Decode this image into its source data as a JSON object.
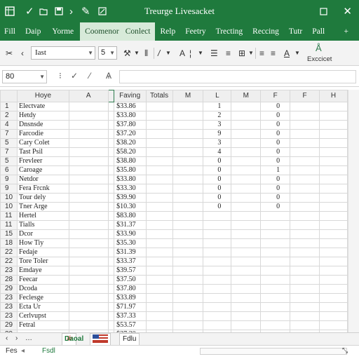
{
  "window": {
    "title": "Treurge Livesacket",
    "app_icon": "spreadsheet-icon",
    "qa_icons": [
      "check-icon",
      "folder-icon",
      "box-icon",
      "chevron-right-icon",
      "edit-icon"
    ],
    "right_icons": [
      "restore-icon",
      "close-icon"
    ]
  },
  "ribbon": {
    "tabs": [
      "Fill",
      "Daip",
      "Yorme",
      "Coomenor",
      "Conlect",
      "Relp",
      "Feetry",
      "Trecting",
      "Reccing",
      "Tutr",
      "Pall"
    ],
    "active_index": 3,
    "collapse_icon": "plus-icon"
  },
  "toolbar": {
    "font_name": "Iast",
    "font_size": "5",
    "excelt_label": "Exccicet"
  },
  "formula": {
    "name_box": "80"
  },
  "columns": [
    "Hoye",
    "A",
    "",
    "Faving",
    "Totals",
    "M",
    "L",
    "M",
    "F",
    "F",
    "H"
  ],
  "rows": [
    {
      "num": "1",
      "name": "Electvate",
      "price": "$33.86",
      "l": "1",
      "f": "0"
    },
    {
      "num": "2",
      "name": "Hetdy",
      "price": "$33.80",
      "l": "2",
      "f": "0"
    },
    {
      "num": "4",
      "name": "Dnsnsde",
      "price": "$37.80",
      "l": "3",
      "f": "0"
    },
    {
      "num": "7",
      "name": "Farcodie",
      "price": "$37.20",
      "l": "9",
      "f": "0"
    },
    {
      "num": "5",
      "name": "Cary Colet",
      "price": "$38.20",
      "l": "3",
      "f": "0"
    },
    {
      "num": "7",
      "name": "Tast Psil",
      "price": "$58.20",
      "l": "4",
      "f": "0"
    },
    {
      "num": "5",
      "name": "Frevleer",
      "price": "$38.80",
      "l": "0",
      "f": "0"
    },
    {
      "num": "6",
      "name": "Caroage",
      "price": "$35.80",
      "l": "0",
      "f": "1"
    },
    {
      "num": "9",
      "name": "Netdor",
      "price": "$33.80",
      "l": "0",
      "f": "0"
    },
    {
      "num": "9",
      "name": "Fera Frcnk",
      "price": "$33.30",
      "l": "0",
      "f": "0"
    },
    {
      "num": "10",
      "name": "Tour dely",
      "price": "$39.90",
      "l": "0",
      "f": "0"
    },
    {
      "num": "10",
      "name": "Tner Arge",
      "price": "$10.30",
      "l": "0",
      "f": "0"
    },
    {
      "num": "11",
      "name": "Hertel",
      "price": "$83.80",
      "l": "",
      "f": ""
    },
    {
      "num": "11",
      "name": "Tialls",
      "price": "$31.37",
      "l": "",
      "f": ""
    },
    {
      "num": "15",
      "name": "Dcor",
      "price": "$33.90",
      "l": "",
      "f": ""
    },
    {
      "num": "18",
      "name": "How Tiy",
      "price": "$35.30",
      "l": "",
      "f": ""
    },
    {
      "num": "22",
      "name": "Fedaje",
      "price": "$31.39",
      "l": "",
      "f": ""
    },
    {
      "num": "22",
      "name": "Tore Toler",
      "price": "$33.37",
      "l": "",
      "f": ""
    },
    {
      "num": "23",
      "name": "Emdaye",
      "price": "$39.57",
      "l": "",
      "f": ""
    },
    {
      "num": "28",
      "name": "Feecar",
      "price": "$37.50",
      "l": "",
      "f": ""
    },
    {
      "num": "29",
      "name": "Dcoda",
      "price": "$37.80",
      "l": "",
      "f": ""
    },
    {
      "num": "23",
      "name": "Feclesge",
      "price": "$33.89",
      "l": "",
      "f": ""
    },
    {
      "num": "23",
      "name": "Ecta Ur",
      "price": "$71.97",
      "l": "",
      "f": ""
    },
    {
      "num": "23",
      "name": "Cerlvupst",
      "price": "$37.33",
      "l": "",
      "f": ""
    },
    {
      "num": "29",
      "name": "Fetral",
      "price": "$53.57",
      "l": "",
      "f": ""
    },
    {
      "num": "39",
      "name": "",
      "price": "$37.30",
      "l": "",
      "f": ""
    }
  ],
  "sheets": {
    "tabs": [
      "Jlr",
      "Daoal",
      "Fdlu"
    ],
    "active_index": 0,
    "active_sub": "Fsdl"
  },
  "status": {
    "left": "Fes"
  }
}
